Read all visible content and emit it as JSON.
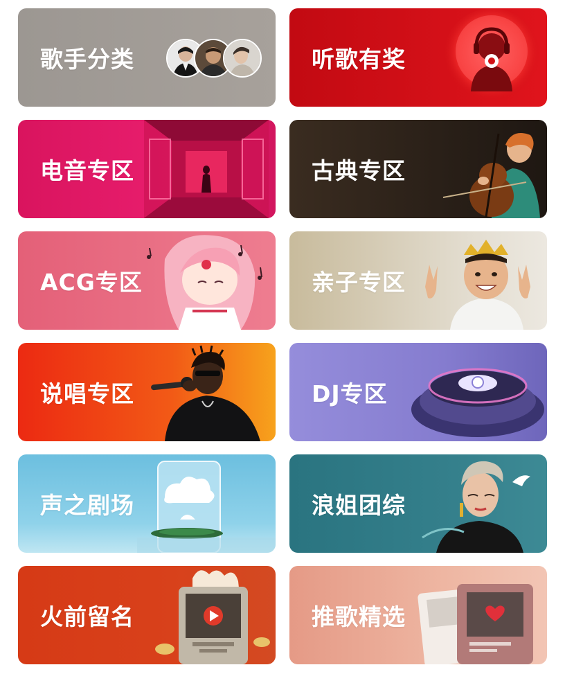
{
  "categories": [
    {
      "label": "歌手分类",
      "bg": "#a29d98",
      "icon": "singer-avatars"
    },
    {
      "label": "听歌有奖",
      "bg": "#d31116",
      "icon": "headphone-listener"
    },
    {
      "label": "电音专区",
      "bg": "#e0196a",
      "icon": "neon-corridor"
    },
    {
      "label": "古典专区",
      "bg": "#2a2018",
      "icon": "cellist"
    },
    {
      "label": "ACG专区",
      "bg": "#e86b82",
      "icon": "anime-girl"
    },
    {
      "label": "亲子专区",
      "bg": "#cbbfa3",
      "icon": "child-with-crown"
    },
    {
      "label": "说唱专区",
      "bg": "#ee3a16",
      "icon": "rapper-with-mic"
    },
    {
      "label": "DJ专区",
      "bg": "#8e85d8",
      "icon": "dj-turntable"
    },
    {
      "label": "声之剧场",
      "bg": "#7ac6e0",
      "icon": "cloud-island-phone"
    },
    {
      "label": "浪姐团综",
      "bg": "#2f7d86",
      "icon": "singer-portrait"
    },
    {
      "label": "火前留名",
      "bg": "#d9401a",
      "icon": "flaming-album"
    },
    {
      "label": "推歌精选",
      "bg": "#e9a895",
      "icon": "album-cards"
    }
  ]
}
